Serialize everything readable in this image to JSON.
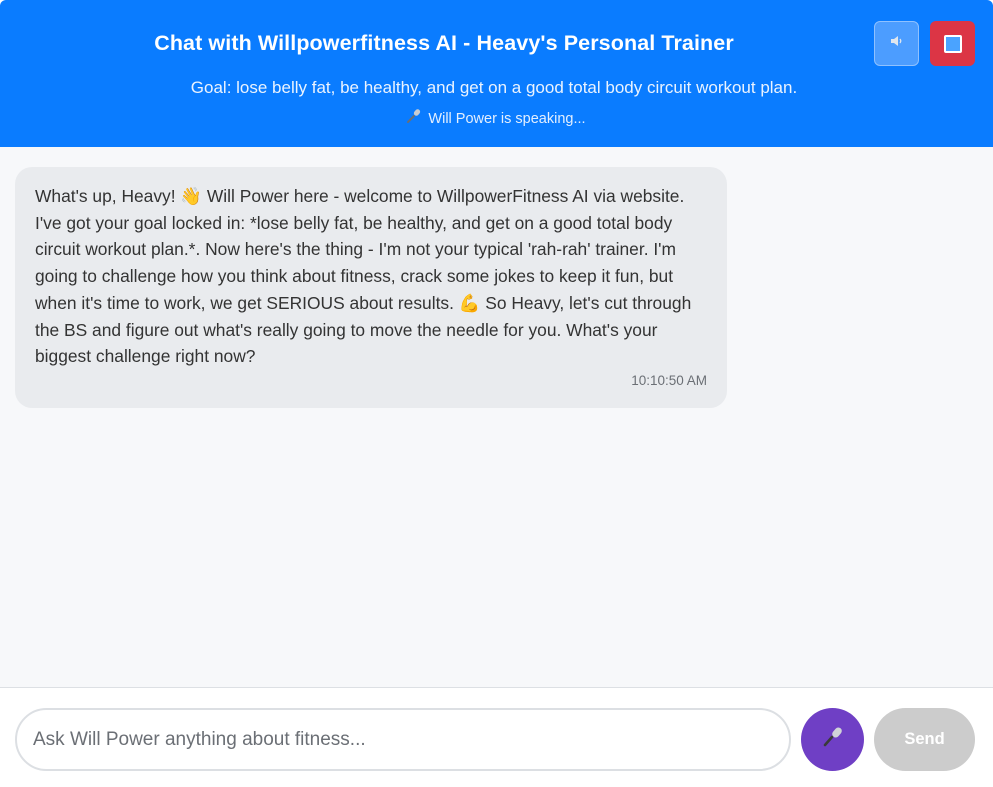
{
  "header": {
    "title": "Chat with Willpowerfitness AI - Heavy's Personal Trainer",
    "goal": "Goal: lose belly fat, be healthy, and get on a good total body circuit workout plan.",
    "status": "Will Power is speaking...",
    "speaker_button_icon": "speaker-icon",
    "stop_button_icon": "stop-icon"
  },
  "messages": [
    {
      "sender": "Will Power",
      "text": "What's up, Heavy! 👋 Will Power here - welcome to WillpowerFitness AI via website. I've got your goal locked in: *lose belly fat, be healthy, and get on a good total body circuit workout plan.*. Now here's the thing - I'm not your typical 'rah-rah' trainer. I'm going to challenge how you think about fitness, crack some jokes to keep it fun, but when it's time to work, we get SERIOUS about results. 💪 So Heavy, let's cut through the BS and figure out what's really going to move the needle for you. What's your biggest challenge right now?",
      "time": "10:10:50 AM"
    }
  ],
  "composer": {
    "placeholder": "Ask Will Power anything about fitness...",
    "value": "",
    "mic_icon": "microphone-icon",
    "send_label": "Send"
  },
  "colors": {
    "header_bg": "#0a7cff",
    "stop_button": "#dc3545",
    "mic_button": "#6f3fc5",
    "send_button_disabled": "#cccccc",
    "bubble_bg": "#e9ebee",
    "messages_bg": "#f7f8fa"
  }
}
